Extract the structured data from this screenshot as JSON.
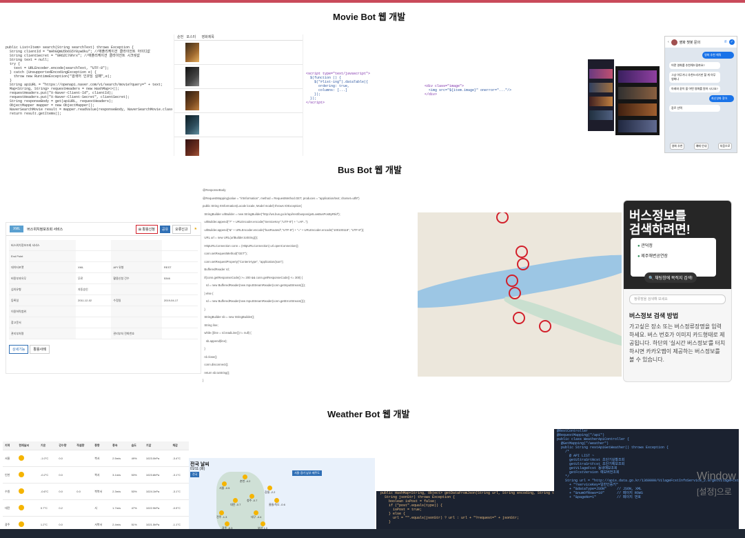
{
  "headings": {
    "movie": "Movie Bot 웹 개발",
    "bus": "Bus Bot 웹 개발",
    "weather": "Weather Bot 웹 개발"
  },
  "movie": {
    "code_lines": [
      "public List<Item> search(String searchText) throws Exception {",
      "  String clientId = \"mAhGQmU5b6S5Y8ywOku\"; //애플리케이션 클라이언트 아이디값",
      "  String clientSecret = \"8ROZC70hrx\"; //애플리케이션 클라이언트 시크릿값",
      "",
      "  String text = null;",
      "  try {",
      "    text = URLEncoder.encode(searchText, \"UTF-8\");",
      "  } catch (UnsupportedEncodingException e) {",
      "    throw new RuntimeException(\"검색어 인코딩 실패\",e);",
      "  }",
      "",
      "  String apiURL = \"https://openapi.naver.com/v1/search/movie?query=\" + text;",
      "",
      "  Map<String, String> requestHeaders = new HashMap<>();",
      "  requestHeaders.put(\"X-Naver-Client-Id\", clientId);",
      "  requestHeaders.put(\"X-Naver-Client-Secret\", clientSecret);",
      "  String responseBody = get(apiURL, requestHeaders);",
      "",
      "  ObjectMapper mapper = new ObjectMapper();",
      "  NaverSearchMovie result = mapper.readValue(responseBody, NaverSearchMovie.class);",
      "  return result.getItems();"
    ],
    "chat": {
      "title": "영화 챗봇 문의",
      "bubble1": "영화 추천 해줘",
      "bubble2": "어떤 영화를 추천해드릴까요?",
      "bubble3": "그냥 아무거나 추천드리기만 할 게 아무 영화나",
      "bubble4": "아래와 같이 을 어떤 영화를 원하 시나요?",
      "bubble5": "최신영화 찾아",
      "bubble6": "장르 선택",
      "quick1": "영화 추천",
      "quick2": "예매 안내",
      "quick3": "처음으로"
    }
  },
  "bus": {
    "site_title": "버스위치정보조회 서비스",
    "tag": "XML",
    "btn_apply": "활용신청",
    "btn_share": "공유",
    "btn_error": "오류신고",
    "fields": [
      {
        "k": "버스위치정보조회 서비스",
        "v": ""
      },
      {
        "k": "End Point",
        "v": ""
      },
      {
        "k": "데이터포맷",
        "v": "XML",
        "k2": "API 유형",
        "v2": "REST"
      },
      {
        "k": "비용부과유무",
        "v": "무료",
        "k2": "활용신청 건수",
        "v2": "5346"
      },
      {
        "k": "심의유형",
        "v": "자동승인",
        "k2": "",
        "v2": ""
      },
      {
        "k": "등록일",
        "v": "2011-12-02",
        "k2": "수정일",
        "v2": "2019-04-17"
      },
      {
        "k": "이용허락범위",
        "v": "",
        "k2": "",
        "v2": ""
      },
      {
        "k": "참고문서",
        "v": "",
        "k2": "",
        "v2": ""
      },
      {
        "k": "관리부처명",
        "v": "",
        "k2": "관리부처 전화번호",
        "v2": ""
      }
    ],
    "tab1": "상세기능",
    "tab2": "활용사례",
    "code_lines": [
      "@ResponseBody",
      "@RequestMapping(value = \"/rtInformation\", method = RequestMethod.GET, produces = \"application/text; charset=utf8\")",
      "public String rtInformation(Locale locale, Model model) throws IOException{",
      "  StringBuilder urlBuilder = new StringBuilder(\"http://ws.bus.go.kr/api/rest/buspos/getLowBusPosByRtid\");",
      "",
      "  urlBuilder.append(\"?\" + URLEncoder.encode(\"ServiceKey\",\"UTF-8\") + \"=AP...\");",
      "  urlBuilder.append(\"&\" + URLEncoder.encode(\"busRouteId\",\"UTF-8\") + \"=\" + URLEncoder.encode(\"100100118\", \"UTF-8\"));",
      "  URL url = new URL(urlBuilder.toString());",
      "  HttpURLConnection conn = (HttpURLConnection) url.openConnection();",
      "  conn.setRequestMethod(\"GET\");",
      "  conn.setRequestProperty(\"Content-type\", \"application/json\");",
      "",
      "  BufferedReader rd;",
      "  if(conn.getResponseCode() >= 200 && conn.getResponseCode() <= 300) {",
      "    rd = new BufferedReader(new InputStreamReader(conn.getInputStream()));",
      "  } else {",
      "    rd = new BufferedReader(new InputStreamReader(conn.getErrorStream()));",
      "  }",
      "  StringBuilder sb = new StringBuilder();",
      "  String line;",
      "  while ((line = rd.readLine()) != null) {",
      "    sb.append(line);",
      "  }",
      "  rd.close();",
      "  conn.disconnect();",
      "  return sb.toString();",
      "}"
    ],
    "card": {
      "title_line1": "버스정보를",
      "title_line2": "검색하려면!",
      "stop1": "관덕정",
      "stop2": "제주해변공연장",
      "button": "채팅창에 목적지 검색!",
      "search_placeholder": "정류장을 검색해 보세요",
      "method_title": "버스정보 검색 방법",
      "method_body": "가고싶은 장소 또는 버스정류장명을 입력하세요. 버스 번호가 이미지 카드형태로 제공됩니다. 하단의 '실시간 버스정보'를 터치하시면 카카오맵이 제공하는 버스정보를 볼 수 있습니다."
    }
  },
  "weather": {
    "table_headers": [
      "지역",
      "현재날씨",
      "기온",
      "강수량",
      "적설량",
      "풍향",
      "풍속",
      "습도",
      "기압",
      "체감"
    ],
    "table_rows": [
      [
        "서울",
        "",
        "-1.0°C",
        "0.0",
        "",
        "북서",
        "2.5m/s",
        "49%",
        "1023.0hPa",
        "-3.4°C"
      ],
      [
        "인천",
        "",
        "-0.2°C",
        "0.0",
        "",
        "북서",
        "3.1m/s",
        "53%",
        "1023.8hPa",
        "-3.1°C"
      ],
      [
        "수원",
        "",
        "-0.6°C",
        "0.0",
        "0.0",
        "북북서",
        "2.3m/s",
        "53%",
        "1024.1hPa",
        "-3.1°C"
      ],
      [
        "대전",
        "",
        "0.7°C",
        "0.2",
        "",
        "서",
        "1.7m/s",
        "47%",
        "1022.9hPa",
        "-0.5°C"
      ],
      [
        "광주",
        "",
        "1.2°C",
        "0.0",
        "",
        "서북서",
        "2.4m/s",
        "51%",
        "1021.5hPa",
        "-1.1°C"
      ]
    ],
    "map_title": "전국 날씨",
    "map_date": "01/11 (화)",
    "map_badge": "전국",
    "map_badge2": "서울·경기 남부·제주도",
    "cities": [
      "서울 -0.5",
      "춘천 -4.2",
      "강릉 -2.2",
      "대전 -0.7",
      "청주 -0.7",
      "울릉/독도 -0.6",
      "전주 -1.3",
      "대구 -4.4",
      "광주 -0.3",
      "부산 1.0"
    ],
    "code_lines_right": [
      "@RestController",
      "@RequestMapping(\"/api\")",
      "public class WeatherApiController {",
      "",
      "  @GetMapping(\"/weather\")",
      "  public String restApiGetWeather() throws Exception {",
      "    /*",
      "      @ API LIST ~",
      "",
      "      getUltraSrtNcst 초단기실황조회",
      "      getUltraSrtFcst 초단기예보조회",
      "      getVilageFcst 동네예보조회",
      "      getFcstVersion 예보버전조회",
      "    */",
      "    String url = \"http://apis.data.go.kr/1360000/VilageFcstInfoService_2.0/getVilageFcst\"",
      "      + \"?serviceKey=일반인증키\"",
      "      + \"&dataType=JSON\"     // JSON, XML",
      "      + \"&numOfRows=10\"      // 페이지 ROWS",
      "      + \"&pageNo=1\"          // 페이지 번호"
    ],
    "code_lines_mid": [
      "public HashMap<String, Object> getDataFromJson(String url, String encoding, String type",
      "  String jsonStr) throws Exception {",
      "    boolean isPost = false;",
      "",
      "    if (\"post\".equals(type)) {",
      "      isPost = true;",
      "    } else {",
      "      url = \"\".equals(jsonStr) ? url : url + \"?request=\" + jsonStr;",
      "    }"
    ]
  },
  "watermark": {
    "line1": "Window",
    "line2": "[설정]으로"
  }
}
